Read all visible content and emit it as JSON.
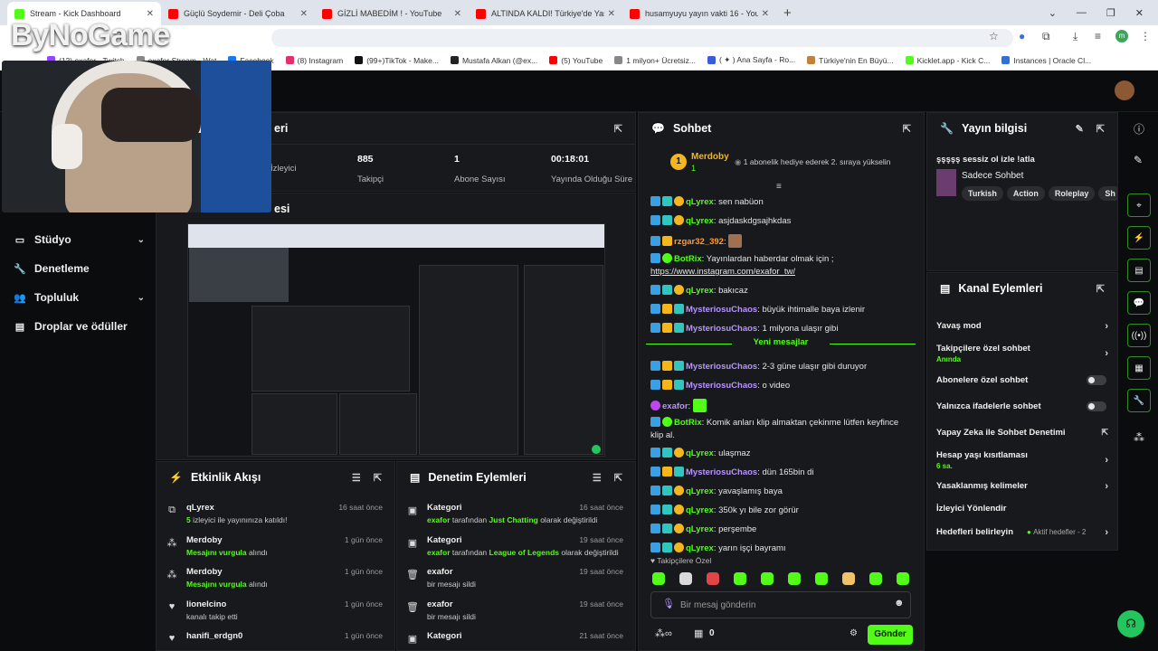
{
  "browser": {
    "tabs": [
      {
        "title": "Stream - Kick Dashboard",
        "icon": "kick-icon"
      },
      {
        "title": "Güçlü Soydemir - Deli Çoba",
        "icon": "youtube-icon"
      },
      {
        "title": "GİZLİ MABEDİM ! - YouTube",
        "icon": "youtube-icon"
      },
      {
        "title": "ALTINDA KALDI! Türkiye'de Yaş",
        "icon": "youtube-icon"
      },
      {
        "title": "husamyuyu yayın vakti 16 - You",
        "icon": "youtube-icon"
      }
    ],
    "new_tab": "+",
    "bookmarks": [
      "(12) exafor - Twitch",
      "exafor Stream - Wat",
      "Facebook",
      "(8) Instagram",
      "(99+)TikTok - Make...",
      "Mustafa Alkan (@ex...",
      "(5) YouTube",
      "1 milyon+ Ücretsiz...",
      "( ✦ ) Ana Sayfa - Ro...",
      "Türkiye'nin En Büyü...",
      "Kicklet.app - Kick C...",
      "Instances | Oracle Cl..."
    ]
  },
  "overlay": {
    "logo_prefix": "By",
    "logo_brand": "NoGame"
  },
  "nav": {
    "items": [
      {
        "label": "Stüdyo",
        "icon": "studio-icon",
        "chevron": true
      },
      {
        "label": "Denetleme",
        "icon": "wrench-icon",
        "chevron": false
      },
      {
        "label": "Topluluk",
        "icon": "community-icon",
        "chevron": true
      },
      {
        "label": "Droplar ve ödüller",
        "icon": "drops-icon",
        "chevron": false
      }
    ]
  },
  "stats": {
    "title_fragment": "eri",
    "items": [
      {
        "label": "İzleyici",
        "value": ""
      },
      {
        "label": "Takipçi",
        "value": "885"
      },
      {
        "label": "Abone Sayısı",
        "value": "1"
      },
      {
        "label": "Yayında Olduğu Süre",
        "value": "00:18:01"
      }
    ]
  },
  "preview_title_fragment": "esi",
  "activity": {
    "title": "Etkinlik Akışı",
    "items": [
      {
        "name": "qLyrex",
        "time": "16 saat önce",
        "highlight": "5",
        "desc": " izleyici ile yayınınıza katıldı!",
        "icon": "raid-icon"
      },
      {
        "name": "Merdoby",
        "time": "1 gün önce",
        "highlight": "Mesajını vurgula",
        "desc": " alındı",
        "icon": "points-icon"
      },
      {
        "name": "Merdoby",
        "time": "1 gün önce",
        "highlight": "Mesajını vurgula",
        "desc": " alındı",
        "icon": "points-icon"
      },
      {
        "name": "lionelcino",
        "time": "1 gün önce",
        "highlight": "",
        "desc": "kanalı takip etti",
        "icon": "heart-icon"
      },
      {
        "name": "hanifi_erdgn0",
        "time": "1 gün önce",
        "highlight": "",
        "desc": "",
        "icon": "heart-icon"
      }
    ]
  },
  "moderation": {
    "title": "Denetim Eylemleri",
    "items": [
      {
        "name": "Kategori",
        "time": "16 saat önce",
        "actor": "exafor",
        "mid": " tarafından ",
        "value": "Just Chatting",
        "tail": " olarak değiştirildi",
        "icon": "category-icon"
      },
      {
        "name": "Kategori",
        "time": "19 saat önce",
        "actor": "exafor",
        "mid": " tarafından ",
        "value": "League of Legends",
        "tail": " olarak değiştirildi",
        "icon": "category-icon"
      },
      {
        "name": "exafor",
        "time": "19 saat önce",
        "actor": "",
        "mid": "",
        "value": "",
        "tail": "bir mesajı sildi",
        "icon": "trash-icon"
      },
      {
        "name": "exafor",
        "time": "19 saat önce",
        "actor": "",
        "mid": "",
        "value": "",
        "tail": "bir mesajı sildi",
        "icon": "trash-icon"
      },
      {
        "name": "Kategori",
        "time": "21 saat önce",
        "actor": "",
        "mid": "",
        "value": "",
        "tail": "",
        "icon": "category-icon"
      }
    ]
  },
  "chat": {
    "title": "Sohbet",
    "pinned_user": "Merdoby",
    "pinned_rank": "1",
    "pinned_gift_count": "1",
    "pinned_text": "1 abonelik hediye ederek 2. sıraya yükselin",
    "new_messages": "Yeni mesajlar",
    "messages": [
      {
        "user": "qLyrex",
        "color": "ug",
        "badges": [
          "b1",
          "b2",
          "b3"
        ],
        "text": "sen nabüon"
      },
      {
        "user": "qLyrex",
        "color": "ug",
        "badges": [
          "b1",
          "b2",
          "b3"
        ],
        "text": "asjdaskdgsajhkdas"
      },
      {
        "user": "rzgar32_392",
        "color": "uo",
        "badges": [
          "b1",
          "b4"
        ],
        "text": ""
      },
      {
        "user": "BotRix",
        "color": "ug",
        "badges": [
          "b1",
          "b5"
        ],
        "text": "Yayınlardan haberdar olmak için ;",
        "link": "https://www.instagram.com/exafor_tw/"
      },
      {
        "user": "qLyrex",
        "color": "ug",
        "badges": [
          "b1",
          "b2",
          "b3"
        ],
        "text": "bakıcaz"
      },
      {
        "user": "MysteriosuChaos",
        "color": "uv",
        "badges": [
          "b1",
          "b4",
          "b2"
        ],
        "text": "büyük ihtimalle baya izlenir"
      },
      {
        "user": "MysteriosuChaos",
        "color": "uv",
        "badges": [
          "b1",
          "b4",
          "b2"
        ],
        "text": "1 milyona ulaşır gibi"
      },
      {
        "user": "MysteriosuChaos",
        "color": "uv",
        "badges": [
          "b1",
          "b4",
          "b2"
        ],
        "text": "2-3 güne ulaşır gibi duruyor"
      },
      {
        "user": "MysteriosuChaos",
        "color": "uv",
        "badges": [
          "b1",
          "b4",
          "b2"
        ],
        "text": "o video"
      },
      {
        "user": "exafor",
        "color": "uv",
        "badges": [
          "b6"
        ],
        "text": ""
      },
      {
        "user": "BotRix",
        "color": "ug",
        "badges": [
          "b1",
          "b5"
        ],
        "text": "Komik anları klip almaktan çekinme lütfen keyfince klip al."
      },
      {
        "user": "qLyrex",
        "color": "ug",
        "badges": [
          "b1",
          "b2",
          "b3"
        ],
        "text": "ulaşmaz"
      },
      {
        "user": "MysteriosuChaos",
        "color": "uv",
        "badges": [
          "b1",
          "b4",
          "b2"
        ],
        "text": "dün 165bin di"
      },
      {
        "user": "qLyrex",
        "color": "ug",
        "badges": [
          "b1",
          "b2",
          "b3"
        ],
        "text": "yavaşlamış baya"
      },
      {
        "user": "qLyrex",
        "color": "ug",
        "badges": [
          "b1",
          "b2",
          "b3"
        ],
        "text": "350k yı bile zor görür"
      },
      {
        "user": "qLyrex",
        "color": "ug",
        "badges": [
          "b1",
          "b2",
          "b3"
        ],
        "text": "perşembe"
      },
      {
        "user": "qLyrex",
        "color": "ug",
        "badges": [
          "b1",
          "b2",
          "b3"
        ],
        "text": "yarın işçi bayramı"
      }
    ],
    "emote_label": "Takipçilere Özel",
    "input_placeholder": "Bir mesaj gönderin",
    "points": "0",
    "send_label": "Gönder"
  },
  "stream_info": {
    "title": "Yayın bilgisi",
    "stream_title": "şşşşş sessiz ol izle !atla",
    "category": "Sadece Sohbet",
    "tags": [
      "Turkish",
      "Action",
      "Roleplay",
      "Sh"
    ]
  },
  "channel_actions": {
    "title": "Kanal Eylemleri",
    "items": [
      {
        "label": "Yavaş mod",
        "sub": "",
        "control": "chevron"
      },
      {
        "label": "Takipçilere özel sohbet",
        "sub": "Anında",
        "control": "chevron"
      },
      {
        "label": "Abonelere özel sohbet",
        "sub": "",
        "control": "toggle"
      },
      {
        "label": "Yalnızca ifadelerle sohbet",
        "sub": "",
        "control": "toggle"
      },
      {
        "label": "Yapay Zeka ile Sohbet Denetimi",
        "sub": "",
        "control": "external"
      },
      {
        "label": "Hesap yaşı kısıtlaması",
        "sub": "6 sa.",
        "control": "chevron"
      },
      {
        "label": "Yasaklanmış kelimeler",
        "sub": "",
        "control": "chevron"
      },
      {
        "label": "İzleyici Yönlendir",
        "sub": "",
        "control": "none"
      },
      {
        "label": "Hedefleri belirleyin",
        "sub": "",
        "control": "goal",
        "extra": "Aktif hedefler - 2"
      }
    ]
  },
  "colors": {
    "accent": "#53fc18",
    "panel": "#18191c",
    "bg": "#0b0c0e"
  }
}
